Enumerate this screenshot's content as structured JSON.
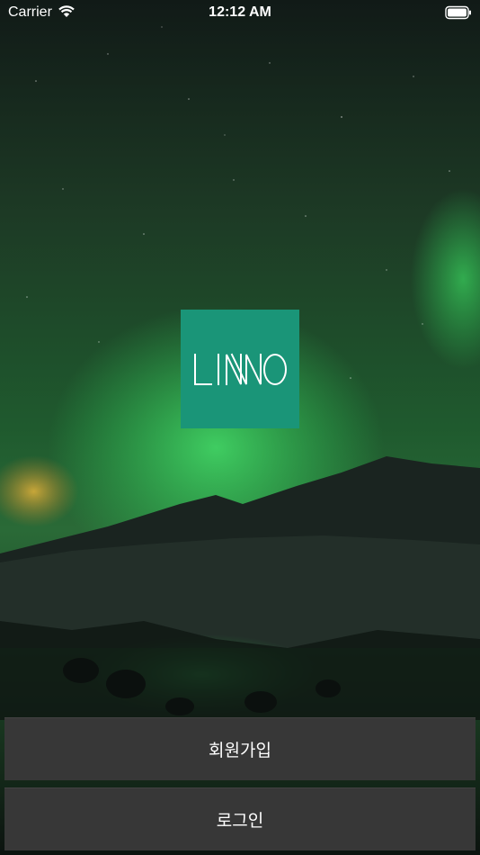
{
  "status_bar": {
    "carrier": "Carrier",
    "time": "12:12 AM"
  },
  "logo": {
    "text": "LINNO",
    "background": "#1a9578"
  },
  "buttons": {
    "signup_label": "회원가입",
    "login_label": "로그인"
  },
  "colors": {
    "button_background": "#373737",
    "aurora_green": "#2fd35a"
  }
}
